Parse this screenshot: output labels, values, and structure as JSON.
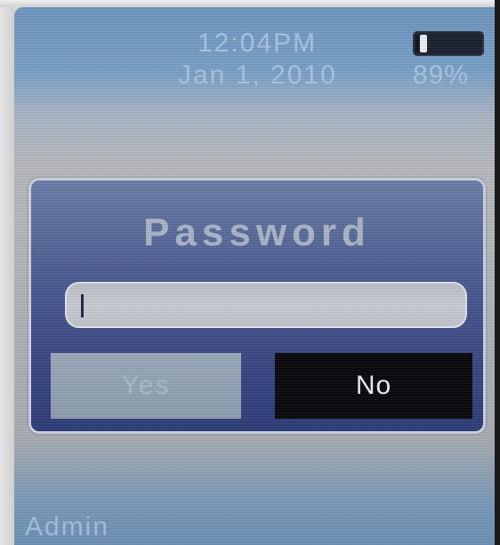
{
  "status": {
    "time": "12:04PM",
    "date": "Jan 1, 2010",
    "battery_percent": "89%",
    "battery_icon": "battery-icon",
    "battery_level": 0.89
  },
  "dialog": {
    "title": "Password",
    "input": {
      "value": "",
      "placeholder": ""
    },
    "buttons": {
      "yes_label": "Yes",
      "no_label": "No"
    }
  },
  "footer": {
    "label": "Admin"
  },
  "colors": {
    "status_text": "#a9c4e0",
    "dialog_bg": "#3d4c86",
    "dialog_border": "#c9d3e3",
    "selected_button": "#0a0a0f",
    "unselected_button": "#9aa8b8"
  }
}
